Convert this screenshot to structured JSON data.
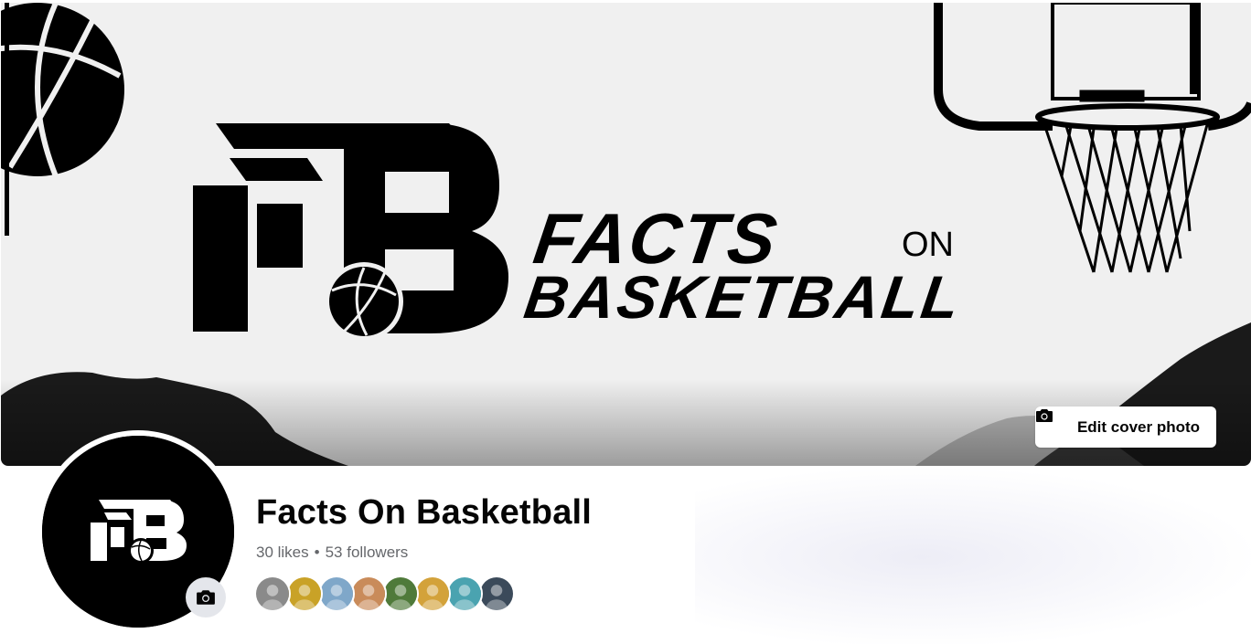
{
  "cover": {
    "logo_line1": "FACTS",
    "logo_on": "ON",
    "logo_line2": "BASKETBALL",
    "edit_button_label": "Edit cover photo"
  },
  "profile": {
    "name": "Facts On Basketball",
    "likes": "30 likes",
    "separator": "•",
    "followers": "53 followers"
  },
  "follower_avatars": [
    {
      "name": "follower-avatar-1",
      "color": "#8a8a8a"
    },
    {
      "name": "follower-avatar-2",
      "color": "#c9a227"
    },
    {
      "name": "follower-avatar-3",
      "color": "#7fa7c9"
    },
    {
      "name": "follower-avatar-4",
      "color": "#c98b5a"
    },
    {
      "name": "follower-avatar-5",
      "color": "#4f7a3a"
    },
    {
      "name": "follower-avatar-6",
      "color": "#d3a23a"
    },
    {
      "name": "follower-avatar-7",
      "color": "#4aa3b0"
    },
    {
      "name": "follower-avatar-8",
      "color": "#3b4a5a"
    }
  ],
  "icons": {
    "camera": "camera-icon"
  }
}
